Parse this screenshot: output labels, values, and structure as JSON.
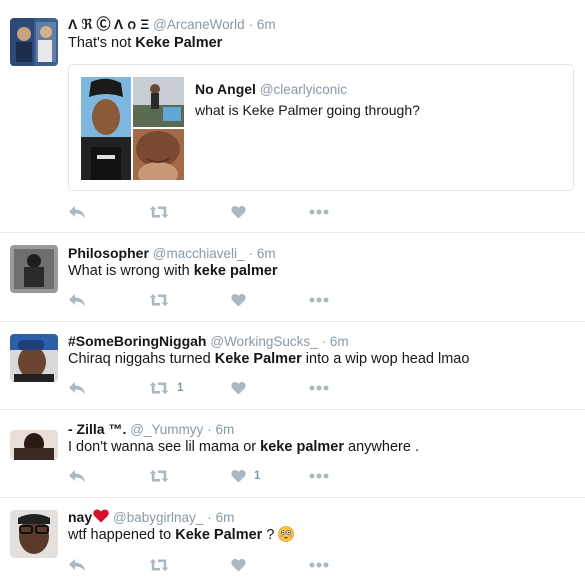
{
  "tweets": [
    {
      "name": "Λ ℜ Ⓒ Λ ᨣ Ξ",
      "handle": "@ArcaneWorld",
      "time": "6m",
      "text_parts": [
        "That's not ",
        "Keke Palmer"
      ],
      "quote": {
        "name": "No Angel",
        "handle": "@clearlyiconic",
        "text": "what is Keke Palmer going through?"
      },
      "retweets": "",
      "likes": ""
    },
    {
      "name": "Philosopher",
      "handle": "@macchiaveli_",
      "time": "6m",
      "text_parts": [
        "What is wrong with ",
        "keke palmer"
      ],
      "retweets": "",
      "likes": ""
    },
    {
      "name": "#SomeBoringNiggah",
      "handle": "@WorkingSucks_",
      "time": "6m",
      "text_parts": [
        "Chiraq niggahs turned ",
        "Keke Palmer",
        " into a wip wop head lmao"
      ],
      "retweets": "1",
      "likes": ""
    },
    {
      "name": "- Zilla ™.",
      "handle": "@_Yummyy",
      "time": "6m",
      "text_parts": [
        "I don't wanna see lil mama or ",
        "keke palmer",
        " anywhere ."
      ],
      "retweets": "",
      "likes": "1"
    },
    {
      "name": "nay",
      "name_icon": "red-heart-icon",
      "handle": "@babygirlnay_",
      "time": "6m",
      "text_parts": [
        "wtf happened to ",
        "Keke Palmer",
        " ? "
      ],
      "trailing_icon": "flushed-face-icon",
      "retweets": "",
      "likes": ""
    }
  ],
  "separator": "·",
  "colors": {
    "action_icon": "#aab8c2",
    "muted": "#8899a6",
    "divider": "#e6ecf0",
    "heart": "#e0245e"
  },
  "action_icons": [
    "reply-icon",
    "retweet-icon",
    "like-icon",
    "more-icon"
  ]
}
